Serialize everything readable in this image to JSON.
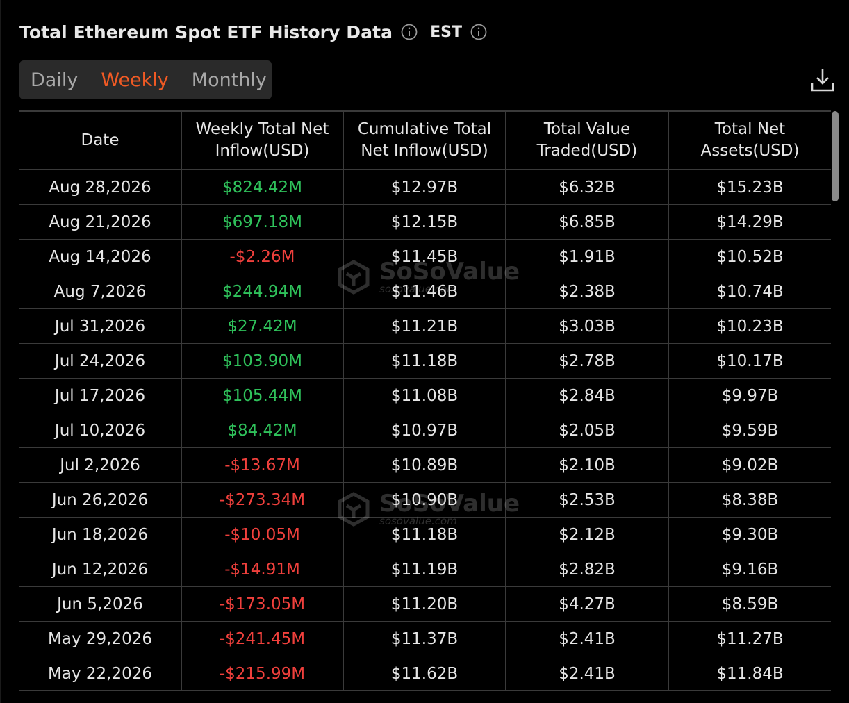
{
  "header": {
    "title": "Total Ethereum Spot ETF History Data",
    "timezone": "EST"
  },
  "tabs": [
    {
      "label": "Daily",
      "active": false
    },
    {
      "label": "Weekly",
      "active": true
    },
    {
      "label": "Monthly",
      "active": false
    }
  ],
  "colors": {
    "accent": "#f05a24",
    "positive": "#2fc25b",
    "negative": "#f0403c",
    "background": "#000000"
  },
  "table": {
    "columns": [
      "Date",
      "Weekly Total Net\nInflow(USD)",
      "Cumulative Total\nNet Inflow(USD)",
      "Total Value\nTraded(USD)",
      "Total Net\nAssets(USD)"
    ],
    "rows": [
      {
        "date": "Aug 28,2026",
        "inflow": "$824.42M",
        "positive": true,
        "cumulative": "$12.97B",
        "traded": "$6.32B",
        "assets": "$15.23B"
      },
      {
        "date": "Aug 21,2026",
        "inflow": "$697.18M",
        "positive": true,
        "cumulative": "$12.15B",
        "traded": "$6.85B",
        "assets": "$14.29B"
      },
      {
        "date": "Aug 14,2026",
        "inflow": "-$2.26M",
        "positive": false,
        "cumulative": "$11.45B",
        "traded": "$1.91B",
        "assets": "$10.52B"
      },
      {
        "date": "Aug 7,2026",
        "inflow": "$244.94M",
        "positive": true,
        "cumulative": "$11.46B",
        "traded": "$2.38B",
        "assets": "$10.74B"
      },
      {
        "date": "Jul 31,2026",
        "inflow": "$27.42M",
        "positive": true,
        "cumulative": "$11.21B",
        "traded": "$3.03B",
        "assets": "$10.23B"
      },
      {
        "date": "Jul 24,2026",
        "inflow": "$103.90M",
        "positive": true,
        "cumulative": "$11.18B",
        "traded": "$2.78B",
        "assets": "$10.17B"
      },
      {
        "date": "Jul 17,2026",
        "inflow": "$105.44M",
        "positive": true,
        "cumulative": "$11.08B",
        "traded": "$2.84B",
        "assets": "$9.97B"
      },
      {
        "date": "Jul 10,2026",
        "inflow": "$84.42M",
        "positive": true,
        "cumulative": "$10.97B",
        "traded": "$2.05B",
        "assets": "$9.59B"
      },
      {
        "date": "Jul 2,2026",
        "inflow": "-$13.67M",
        "positive": false,
        "cumulative": "$10.89B",
        "traded": "$2.10B",
        "assets": "$9.02B"
      },
      {
        "date": "Jun 26,2026",
        "inflow": "-$273.34M",
        "positive": false,
        "cumulative": "$10.90B",
        "traded": "$2.53B",
        "assets": "$8.38B"
      },
      {
        "date": "Jun 18,2026",
        "inflow": "-$10.05M",
        "positive": false,
        "cumulative": "$11.18B",
        "traded": "$2.12B",
        "assets": "$9.30B"
      },
      {
        "date": "Jun 12,2026",
        "inflow": "-$14.91M",
        "positive": false,
        "cumulative": "$11.19B",
        "traded": "$2.82B",
        "assets": "$9.16B"
      },
      {
        "date": "Jun 5,2026",
        "inflow": "-$173.05M",
        "positive": false,
        "cumulative": "$11.20B",
        "traded": "$4.27B",
        "assets": "$8.59B"
      },
      {
        "date": "May 29,2026",
        "inflow": "-$241.45M",
        "positive": false,
        "cumulative": "$11.37B",
        "traded": "$2.41B",
        "assets": "$11.27B"
      },
      {
        "date": "May 22,2026",
        "inflow": "-$215.99M",
        "positive": false,
        "cumulative": "$11.62B",
        "traded": "$2.41B",
        "assets": "$11.84B"
      }
    ]
  },
  "watermark": {
    "brand": "SoSoValue",
    "url": "sosovalue.com"
  },
  "icons": {
    "info": "info-icon",
    "download": "download-icon"
  }
}
